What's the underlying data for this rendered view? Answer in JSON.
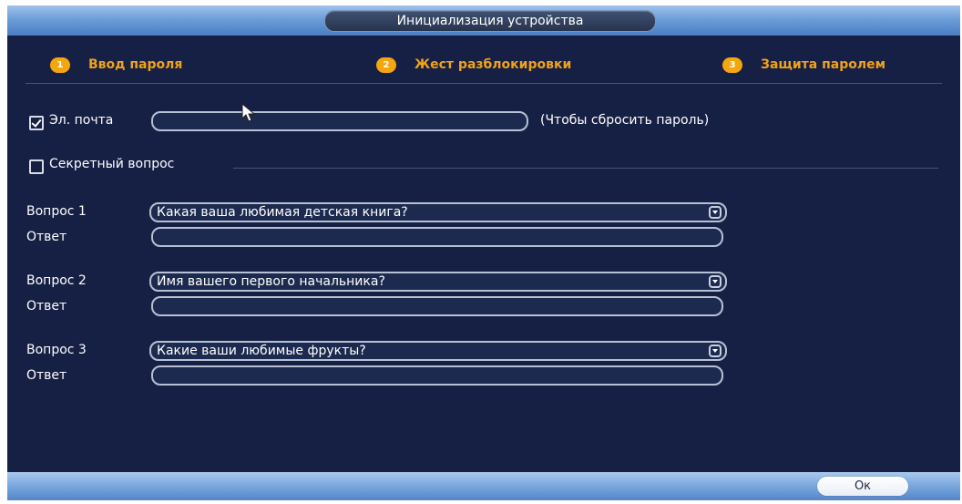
{
  "window": {
    "title": "Инициализация устройства"
  },
  "steps": [
    {
      "number": "1",
      "label": "Ввод пароля"
    },
    {
      "number": "2",
      "label": "Жест разблокировки"
    },
    {
      "number": "3",
      "label": "Защита паролем"
    }
  ],
  "email": {
    "checked": true,
    "label": "Эл. почта",
    "value": "",
    "hint": "(Чтобы сбросить пароль)"
  },
  "secret_question": {
    "checked": false,
    "label": "Секретный вопрос"
  },
  "questions": [
    {
      "label": "Вопрос 1",
      "selected": "Какая ваша любимая детская книга?",
      "answer_label": "Ответ",
      "answer": ""
    },
    {
      "label": "Вопрос 2",
      "selected": "Имя вашего первого начальника?",
      "answer_label": "Ответ",
      "answer": ""
    },
    {
      "label": "Вопрос 3",
      "selected": "Какие ваши любимые фрукты?",
      "answer_label": "Ответ",
      "answer": ""
    }
  ],
  "footer": {
    "ok_label": "Ок"
  },
  "colors": {
    "accent": "#f5a60e",
    "background": "#162044",
    "bar": "#78a6dd"
  }
}
